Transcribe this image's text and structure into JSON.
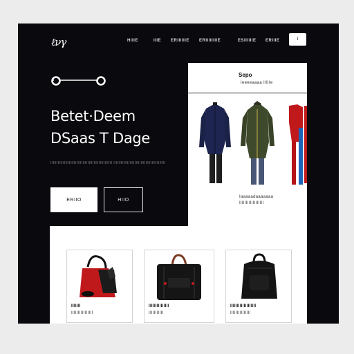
{
  "header": {
    "logo": "ℓνγ",
    "nav": [
      "HIIIE",
      "IIIE",
      "ERIIIIIIE",
      "ERIIIIIIIIE",
      "ESIIIIIIE",
      "ERIIIE"
    ],
    "nav_button": "I"
  },
  "hero": {
    "title_line1": "Betet·Deem",
    "title_line2": "DSaas T Dage",
    "description": "IIIIIIIIIIIIIIIIIIIIIIIIIIIIIIIIIIIIIIIIIIIIIIIIII IIIIIIIIIIIIIIIIIIIIIIIIIIIIIIIIIIIIIIIIII",
    "primary_button": "ERIIO",
    "secondary_button": "HIIO"
  },
  "feature": {
    "heading": "Sepo",
    "subheading": "Ieeeeaaaa IIIIIe",
    "caption_line1": "Iaaaaadaaaaaaa",
    "caption_line2": "IIIIIIIIIIIIIIIIII"
  },
  "products": [
    {
      "name": "IIIIIII",
      "price": "IIIIIIIIIIIIIIII",
      "icon": "red-handbag"
    },
    {
      "name": "IIIIIIIIIIIIIII",
      "price": "IIIIIIIIIII",
      "icon": "black-tote-bag"
    },
    {
      "name": "IIIIIIIIIIIIIIIIIII",
      "price": "IIIIIIIIIIIIIII",
      "icon": "black-backpack"
    }
  ],
  "colors": {
    "background": "#0a0a0e",
    "page": "#ececec",
    "accent_red": "#c0191c",
    "jacket_navy": "#1d2550",
    "jacket_olive": "#3f4a2c"
  }
}
